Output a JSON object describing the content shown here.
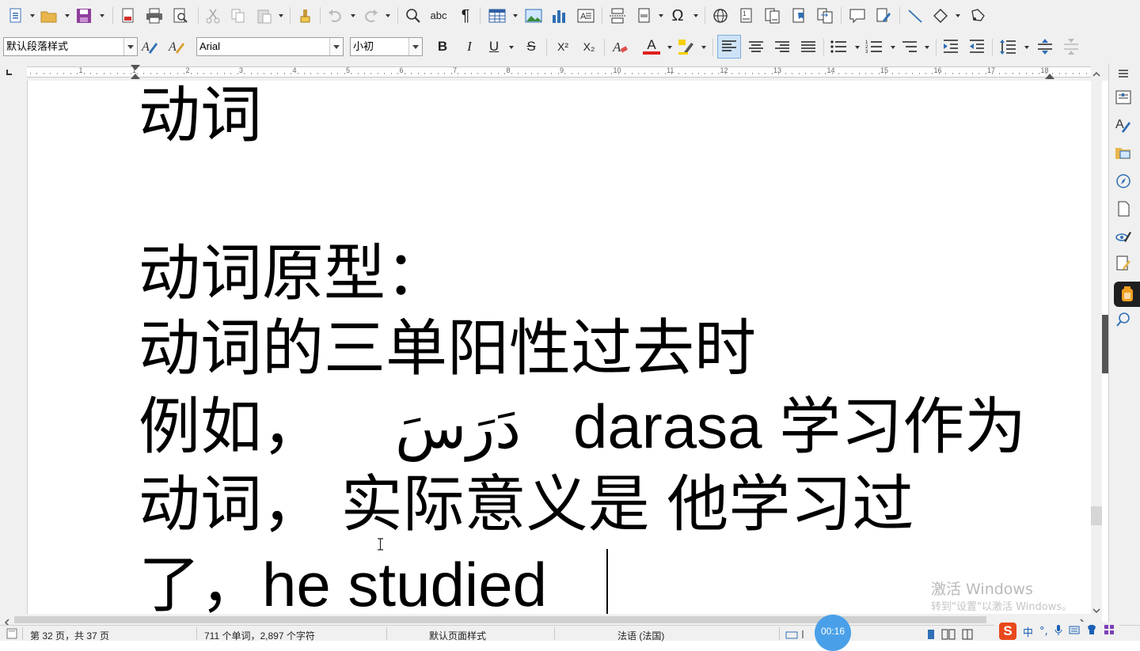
{
  "toolbar1": {
    "icons": [
      "new-document-icon",
      "open-folder-icon",
      "save-icon",
      "export-pdf-icon",
      "print-icon",
      "print-preview-icon",
      "cut-icon",
      "copy-icon",
      "paste-icon",
      "clone-formatting-icon",
      "undo-icon",
      "redo-icon",
      "find-replace-icon",
      "spelling-icon",
      "formatting-marks-icon",
      "table-icon",
      "image-icon",
      "chart-icon",
      "textbox-icon",
      "page-break-icon",
      "field-icon",
      "special-character-icon",
      "hyperlink-icon",
      "footnote-icon",
      "endnote-icon",
      "bookmark-icon",
      "cross-reference-icon",
      "comment-icon",
      "track-changes-icon",
      "line-icon",
      "shapes-icon",
      "draw-icon"
    ],
    "spelling_label": "abc",
    "pilcrow": "¶",
    "omega": "Ω"
  },
  "toolbar2": {
    "paragraph_style": "默认段落样式",
    "font_name": "Arial",
    "font_size": "小初",
    "bold": "B",
    "italic": "I",
    "underline": "U",
    "strikethrough": "S",
    "superscript": "X²",
    "subscript": "X₂",
    "font_color_letter": "A",
    "font_color": "#e02020",
    "highlight_color": "#f5d000"
  },
  "document": {
    "lines": [
      "动词",
      "",
      "动词原型：",
      "动词的三单阳性过去时",
      "例如，",
      "动词，  实际意义是 他学习过",
      "了，he studied"
    ],
    "arabic_word": "دَرَسَ",
    "example_rest": "darasa 学习作为"
  },
  "ruler": {
    "numbers": [
      "1",
      "1",
      "2",
      "3",
      "4",
      "5",
      "6",
      "7",
      "8",
      "9",
      "10",
      "11",
      "12",
      "13",
      "14",
      "15",
      "16",
      "17",
      "18"
    ]
  },
  "statusbar": {
    "page": "第 32 页，共 37 页",
    "words": "711 个单词，2,897 个字符",
    "page_style": "默认页面样式",
    "language": "法语 (法国)"
  },
  "overlay": {
    "watermark_title": "激活 Windows",
    "watermark_sub": "转到\"设置\"以激活 Windows。",
    "timer": "00:16",
    "ime_lang": "中",
    "ime_punct": "°,",
    "accent": "#4aa0e8",
    "sogou_color": "#e8491d"
  }
}
